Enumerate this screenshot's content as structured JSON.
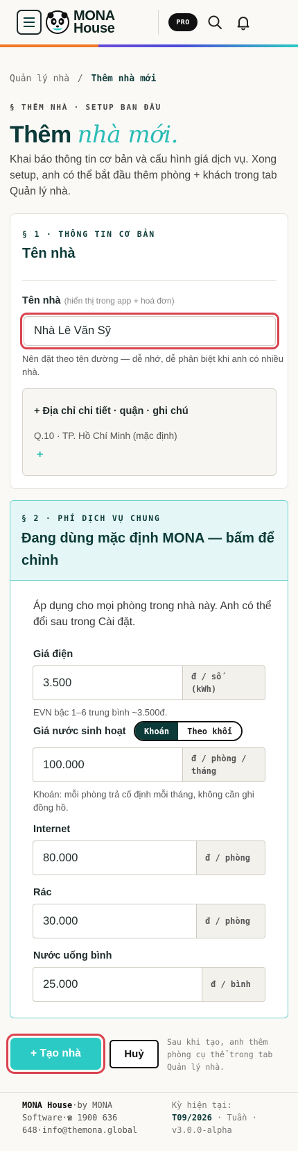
{
  "header": {
    "brand_line1": "MONA",
    "brand_line2": "House",
    "pro_badge": "PRO",
    "icons": [
      "hamburger-menu-icon",
      "panda-logo",
      "search-icon",
      "bell-icon"
    ],
    "accent_gradient": [
      "#f07a2a",
      "#6a4bd8",
      "#2ccac4"
    ]
  },
  "breadcrumb": {
    "root": "Quản lý nhà",
    "sep": "/",
    "current": "Thêm nhà mới"
  },
  "page": {
    "eyebrow": "§ THÊM NHÀ · SETUP BAN ĐẦU",
    "title_strong": "Thêm",
    "title_em": "nhà mới.",
    "description": "Khai báo thông tin cơ bản và cấu hình giá dịch vụ. Xong setup, anh có thể bắt đầu thêm phòng + khách trong tab Quản lý nhà."
  },
  "section1": {
    "label": "§ 1 · THÔNG TIN CƠ BẢN",
    "heading": "Tên nhà",
    "name_field_label": "Tên nhà",
    "name_field_sub": "(hiển thị trong app + hoá đơn)",
    "name_value": "Nhà Lê Văn Sỹ",
    "name_hint": "Nên đặt theo tên đường — dễ nhớ, dễ phân biệt khi anh có nhiều nhà.",
    "address_toggle": "+ Địa chỉ chi tiết · quận · ghi chú",
    "address_default": "Q.10 · TP. Hồ Chí Minh (mặc định)",
    "address_add": "+"
  },
  "section2": {
    "label": "§ 2 · PHÍ DỊCH VỤ CHUNG",
    "heading": "Đang dùng mặc định MONA — bấm để chỉnh",
    "intro": "Áp dụng cho mọi phòng trong nhà này. Anh có thể đổi sau trong Cài đặt.",
    "electric": {
      "label": "Giá điện",
      "value": "3.500",
      "unit_line1": "đ / số",
      "unit_line2": "(kWh)",
      "hint": "EVN bậc 1–6 trung bình ~3.500đ."
    },
    "water": {
      "label": "Giá nước sinh hoạt",
      "toggle_on": "Khoán",
      "toggle_off": "Theo khối",
      "value": "100.000",
      "unit_line1": "đ / phòng /",
      "unit_line2": "tháng",
      "hint": "Khoán: mỗi phòng trả cố định mỗi tháng, không cần ghi đồng hồ."
    },
    "internet": {
      "label": "Internet",
      "value": "80.000",
      "unit": "đ / phòng"
    },
    "trash": {
      "label": "Rác",
      "value": "30.000",
      "unit": "đ / phòng"
    },
    "drinking_water": {
      "label": "Nước uống bình",
      "value": "25.000",
      "unit": "đ / bình"
    }
  },
  "actions": {
    "create": "+ Tạo nhà",
    "cancel": "Huỷ",
    "note": "Sau khi tạo, anh thêm phòng cụ thể trong tab Quản lý nhà."
  },
  "footer": {
    "brand": "MONA House",
    "rest": "·by MONA Software·☎ 1900 636 648·info@themona.global",
    "period_label": "Kỳ hiện tại:",
    "period_value": "T09/2026",
    "period_rest": " · Tuần · v3.0.0-alpha"
  }
}
